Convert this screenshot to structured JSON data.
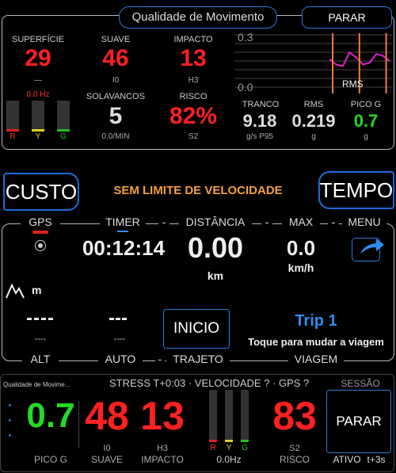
{
  "top_panel": {
    "title": "Qualidade de Movimento",
    "stop_button": "PARAR",
    "surface": {
      "label": "SUPERFÍCIE",
      "value": "29",
      "sub": "—",
      "freq": "0.0 Hz"
    },
    "smooth": {
      "label": "SUAVE",
      "value": "46",
      "sub": "I0"
    },
    "impact": {
      "label": "IMPACTO",
      "value": "13",
      "sub": "H3"
    },
    "bumps": {
      "label": "SOLAVANCOS",
      "value": "5",
      "sub": "0.0/MIN"
    },
    "risk": {
      "label": "RISCO",
      "value": "82%",
      "sub": "S2"
    },
    "stride": {
      "label": "TRANCO",
      "value": "9.18",
      "sub": "g/s P95"
    },
    "rms": {
      "label": "RMS",
      "value": "0.219",
      "sub": "g"
    },
    "peak_g": {
      "label": "PICO G",
      "value": "0.7",
      "sub": "g"
    },
    "bars": {
      "r": "R",
      "y": "Y",
      "g": "G"
    },
    "chart": {
      "ymax_label": "0.3",
      "ymin_label": "0.0",
      "series_label": "RMS"
    }
  },
  "chart_data": {
    "type": "line",
    "title": "",
    "ylabel": "",
    "ylim": [
      0.0,
      0.3
    ],
    "yticks": [
      "0.3",
      "0.0"
    ],
    "series": [
      {
        "name": "RMS",
        "color": "#e020d0",
        "values": [
          0.16,
          0.13,
          0.12,
          0.2,
          0.17,
          0.13,
          0.14,
          0.19,
          0.18,
          0.15
        ]
      }
    ],
    "markers_color": "#ff7a30"
  },
  "nav": {
    "cost_button": "CUSTO",
    "time_button": "TEMPO",
    "speed_limit": "SEM LIMITE DE VELOCIDADE"
  },
  "middle_panel": {
    "tabs": {
      "gps": "GPS",
      "timer": "TIMER",
      "distance": "DISTÂNCIA",
      "max": "MAX",
      "menu": "MENU",
      "sep": "-"
    },
    "timer_value": "00:12:14",
    "distance_value": "0.00",
    "distance_unit": "km",
    "max_value": "0.0",
    "max_unit": "km/h",
    "altitude_unit": "m",
    "alt_value": "----",
    "alt_sub": "----",
    "auto_value": "---",
    "auto_sub": "----",
    "start_button": "INICIO",
    "trip_title": "Trip 1",
    "trip_hint": "Toque para mudar a viagem",
    "bottom_tabs": {
      "alt": "ALT",
      "auto": "AUTO",
      "trajeto": "TRAJETO",
      "viagem": "VIAGEM",
      "sep": "-"
    }
  },
  "bottom_panel": {
    "app_label": "Qualidade de Movime...",
    "status": "STRESS T+0:03 · VELOCIDADE ? · GPS ?",
    "session": "SESSÃO",
    "peak_g": {
      "value": "0.7",
      "label": "PICO G"
    },
    "smooth": {
      "value": "48",
      "sub": "I0",
      "label": "SUAVE"
    },
    "impact": {
      "value": "13",
      "sub": "H3",
      "label": "IMPACTO"
    },
    "freq": "0.0Hz",
    "risk": {
      "value": "83",
      "sub": "S2",
      "label": "RISCO"
    },
    "stop_button": "PARAR",
    "active": "ATIVO",
    "active_time": "t+3s",
    "bars": {
      "r": "R",
      "y": "Y",
      "g": "G"
    }
  },
  "colors": {
    "red": "#ff2020",
    "green": "#22dd22",
    "blue": "#2a7ad8",
    "orange": "#f0a040",
    "trip_blue": "#2f8cf0"
  }
}
